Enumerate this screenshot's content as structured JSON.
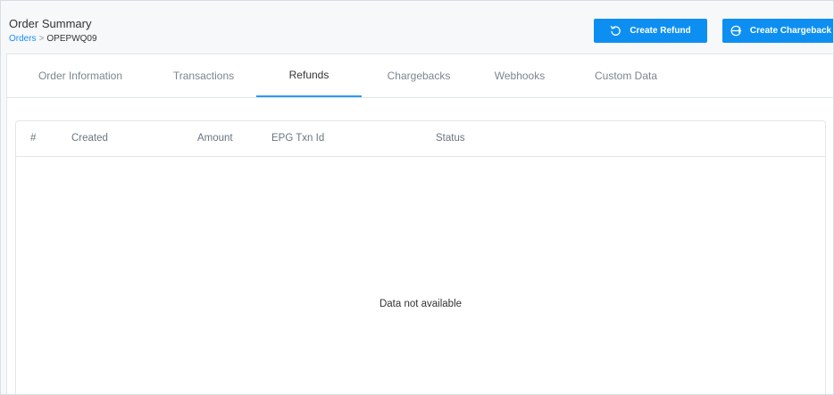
{
  "header": {
    "title": "Order Summary",
    "breadcrumb": {
      "link": "Orders",
      "separator": ">",
      "current": "OPEPWQ09"
    }
  },
  "actions": {
    "create_refund": {
      "label": "Create Refund",
      "icon": "undo-icon"
    },
    "create_chargeback": {
      "label": "Create Chargeback",
      "icon": "chargeback-icon"
    }
  },
  "tabs": [
    {
      "label": "Order Information",
      "active": false
    },
    {
      "label": "Transactions",
      "active": false
    },
    {
      "label": "Refunds",
      "active": true
    },
    {
      "label": "Chargebacks",
      "active": false
    },
    {
      "label": "Webhooks",
      "active": false
    },
    {
      "label": "Custom Data",
      "active": false
    }
  ],
  "table": {
    "columns": [
      "#",
      "Created",
      "Amount",
      "EPG Txn Id",
      "Status"
    ],
    "empty_message": "Data not available"
  },
  "colors": {
    "primary": "#0d8ff2",
    "link": "#1a8cff",
    "tab_active_underline": "#2b9af3"
  }
}
